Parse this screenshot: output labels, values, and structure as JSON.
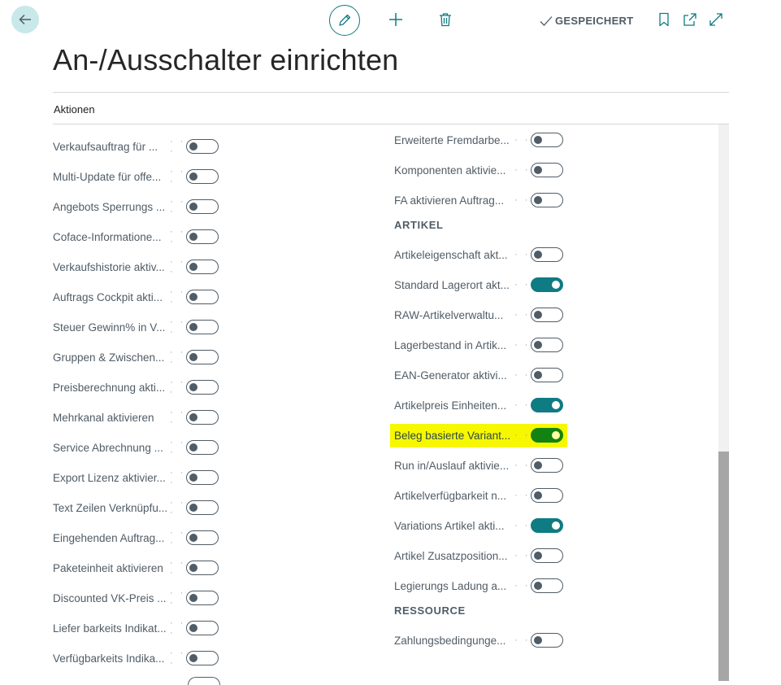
{
  "header": {
    "title": "An-/Ausschalter einrichten",
    "saved_label": "GESPEICHERT",
    "icons": {
      "back": "arrow-left-icon",
      "edit": "pencil-icon",
      "add": "plus-icon",
      "delete": "trash-icon",
      "saved_check": "check-icon",
      "bookmark": "bookmark-icon",
      "open_new": "open-new-window-icon",
      "expand": "expand-icon"
    }
  },
  "actions_label": "Aktionen",
  "colors": {
    "accent": "#0f7b83",
    "highlight": "#f7f700",
    "toggle_on_highlight": "#128212"
  },
  "left_column": [
    {
      "label": "Verkaufsauftrag für ...",
      "on": false
    },
    {
      "label": "Multi-Update für offe...",
      "on": false
    },
    {
      "label": "Angebots Sperrungs ...",
      "on": false
    },
    {
      "label": "Coface-Informatione...",
      "on": false
    },
    {
      "label": "Verkaufshistorie aktiv...",
      "on": false
    },
    {
      "label": "Auftrags Cockpit akti...",
      "on": false
    },
    {
      "label": "Steuer Gewinn% in V...",
      "on": false
    },
    {
      "label": "Gruppen & Zwischen...",
      "on": false
    },
    {
      "label": "Preisberechnung akti...",
      "on": false
    },
    {
      "label": "Mehrkanal aktivieren",
      "on": false
    },
    {
      "label": "Service Abrechnung ...",
      "on": false
    },
    {
      "label": "Export Lizenz aktivier...",
      "on": false
    },
    {
      "label": "Text Zeilen Verknüpfu...",
      "on": false
    },
    {
      "label": "Eingehenden Auftrag...",
      "on": false
    },
    {
      "label": "Paketeinheit aktivieren",
      "on": false
    },
    {
      "label": "Discounted VK-Preis ...",
      "on": false
    },
    {
      "label": "Liefer barkeits Indikat...",
      "on": false
    },
    {
      "label": "Verfügbarkeits Indika...",
      "on": false
    }
  ],
  "right_top": [
    {
      "label": "Erweiterte Fremdarbe...",
      "on": false
    },
    {
      "label": "Komponenten aktivie...",
      "on": false
    },
    {
      "label": "FA aktivieren Auftrag...",
      "on": false
    }
  ],
  "section_artikel": "ARTIKEL",
  "artikel_items": [
    {
      "label": "Artikeleigenschaft akt...",
      "on": false
    },
    {
      "label": "Standard Lagerort akt...",
      "on": true
    },
    {
      "label": "RAW-Artikelverwaltu...",
      "on": false
    },
    {
      "label": "Lagerbestand in Artik...",
      "on": false
    },
    {
      "label": "EAN-Generator aktivi...",
      "on": false
    },
    {
      "label": "Artikelpreis Einheiten...",
      "on": true
    },
    {
      "label": "Beleg basierte Variant...",
      "on": true,
      "highlighted": true
    },
    {
      "label": "Run in/Auslauf aktivie...",
      "on": false
    },
    {
      "label": "Artikelverfügbarkeit n...",
      "on": false
    },
    {
      "label": "Variations Artikel akti...",
      "on": true
    },
    {
      "label": "Artikel Zusatzposition...",
      "on": false
    },
    {
      "label": "Legierungs Ladung a...",
      "on": false
    }
  ],
  "section_ressource": "RESSOURCE",
  "ressource_items": [
    {
      "label": "Zahlungsbedingunge...",
      "on": false
    }
  ]
}
